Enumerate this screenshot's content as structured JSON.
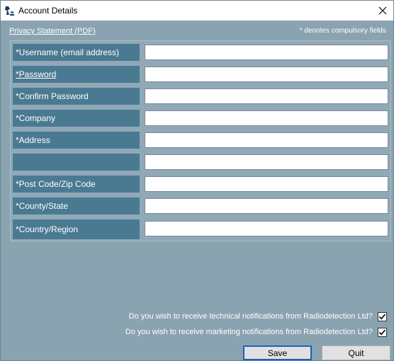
{
  "window": {
    "title": "Account Details",
    "icon": "radiodetection-app-icon",
    "close_icon": "close-icon"
  },
  "header": {
    "privacy_link": "Privacy Statement (PDF)",
    "required_note": "* denotes compulsory fields"
  },
  "form": {
    "fields": [
      {
        "label": "*Username (email address)",
        "value": ""
      },
      {
        "label": "*Password",
        "value": ""
      },
      {
        "label": "*Confirm Password",
        "value": ""
      },
      {
        "label": "*Company",
        "value": ""
      },
      {
        "label": "*Address",
        "value": ""
      },
      {
        "label": "",
        "value": ""
      },
      {
        "label": "*Post Code/Zip Code",
        "value": ""
      },
      {
        "label": "*County/State",
        "value": ""
      },
      {
        "label": "*Country/Region",
        "value": ""
      }
    ]
  },
  "options": {
    "technical_notifications": {
      "label": "Do you wish to receive technical notifications from Radiodetection Ltd?",
      "checked": true
    },
    "marketing_notifications": {
      "label": "Do you wish to receive marketing notifications from Radiodetection Ltd?",
      "checked": true
    }
  },
  "buttons": {
    "save": "Save",
    "quit": "Quit"
  },
  "colors": {
    "window_bg": "#8aa3b1",
    "label_bg": "#4a7a91",
    "default_button_border": "#1f5fbf"
  }
}
